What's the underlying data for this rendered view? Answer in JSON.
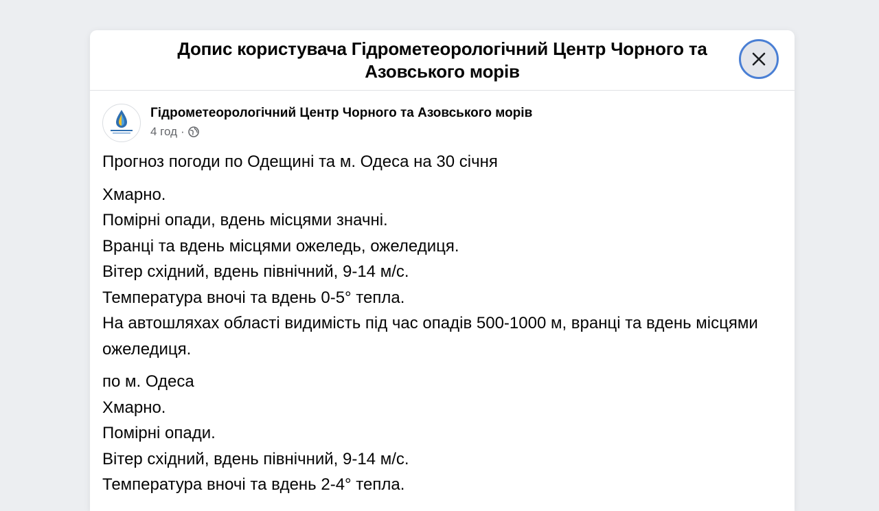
{
  "modal": {
    "title": "Допис користувача Гідрометеорологічний Центр Чорного та Азовського морів",
    "close_icon": "close-icon"
  },
  "post": {
    "author": "Гідрометеорологічний Центр Чорного та Азовського морів",
    "time": "4 год",
    "separator": "·",
    "audience_icon": "globe-icon",
    "heading": "Прогноз погоди по Одещині та м. Одеса на 30 січня",
    "region_lines": [
      "Хмарно.",
      "Помірні опади, вдень місцями значні.",
      "Вранці та вдень місцями ожеледь, ожеледиця.",
      "Вітер східний, вдень північний, 9-14 м/с.",
      "Температура вночі та вдень 0-5° тепла.",
      "На автошляхах області видимість під час опадів 500-1000 м, вранці та вдень місцями ожеледиця."
    ],
    "city_lines": [
      "по м. Одеса",
      "Хмарно.",
      "Помірні опади.",
      "Вітер східний, вдень північний, 9-14 м/с.",
      "Температура вночі та вдень 2-4° тепла."
    ]
  },
  "colors": {
    "backdrop": "#eceef1",
    "close_ring": "#4a7fd4",
    "text_secondary": "#65676b"
  }
}
